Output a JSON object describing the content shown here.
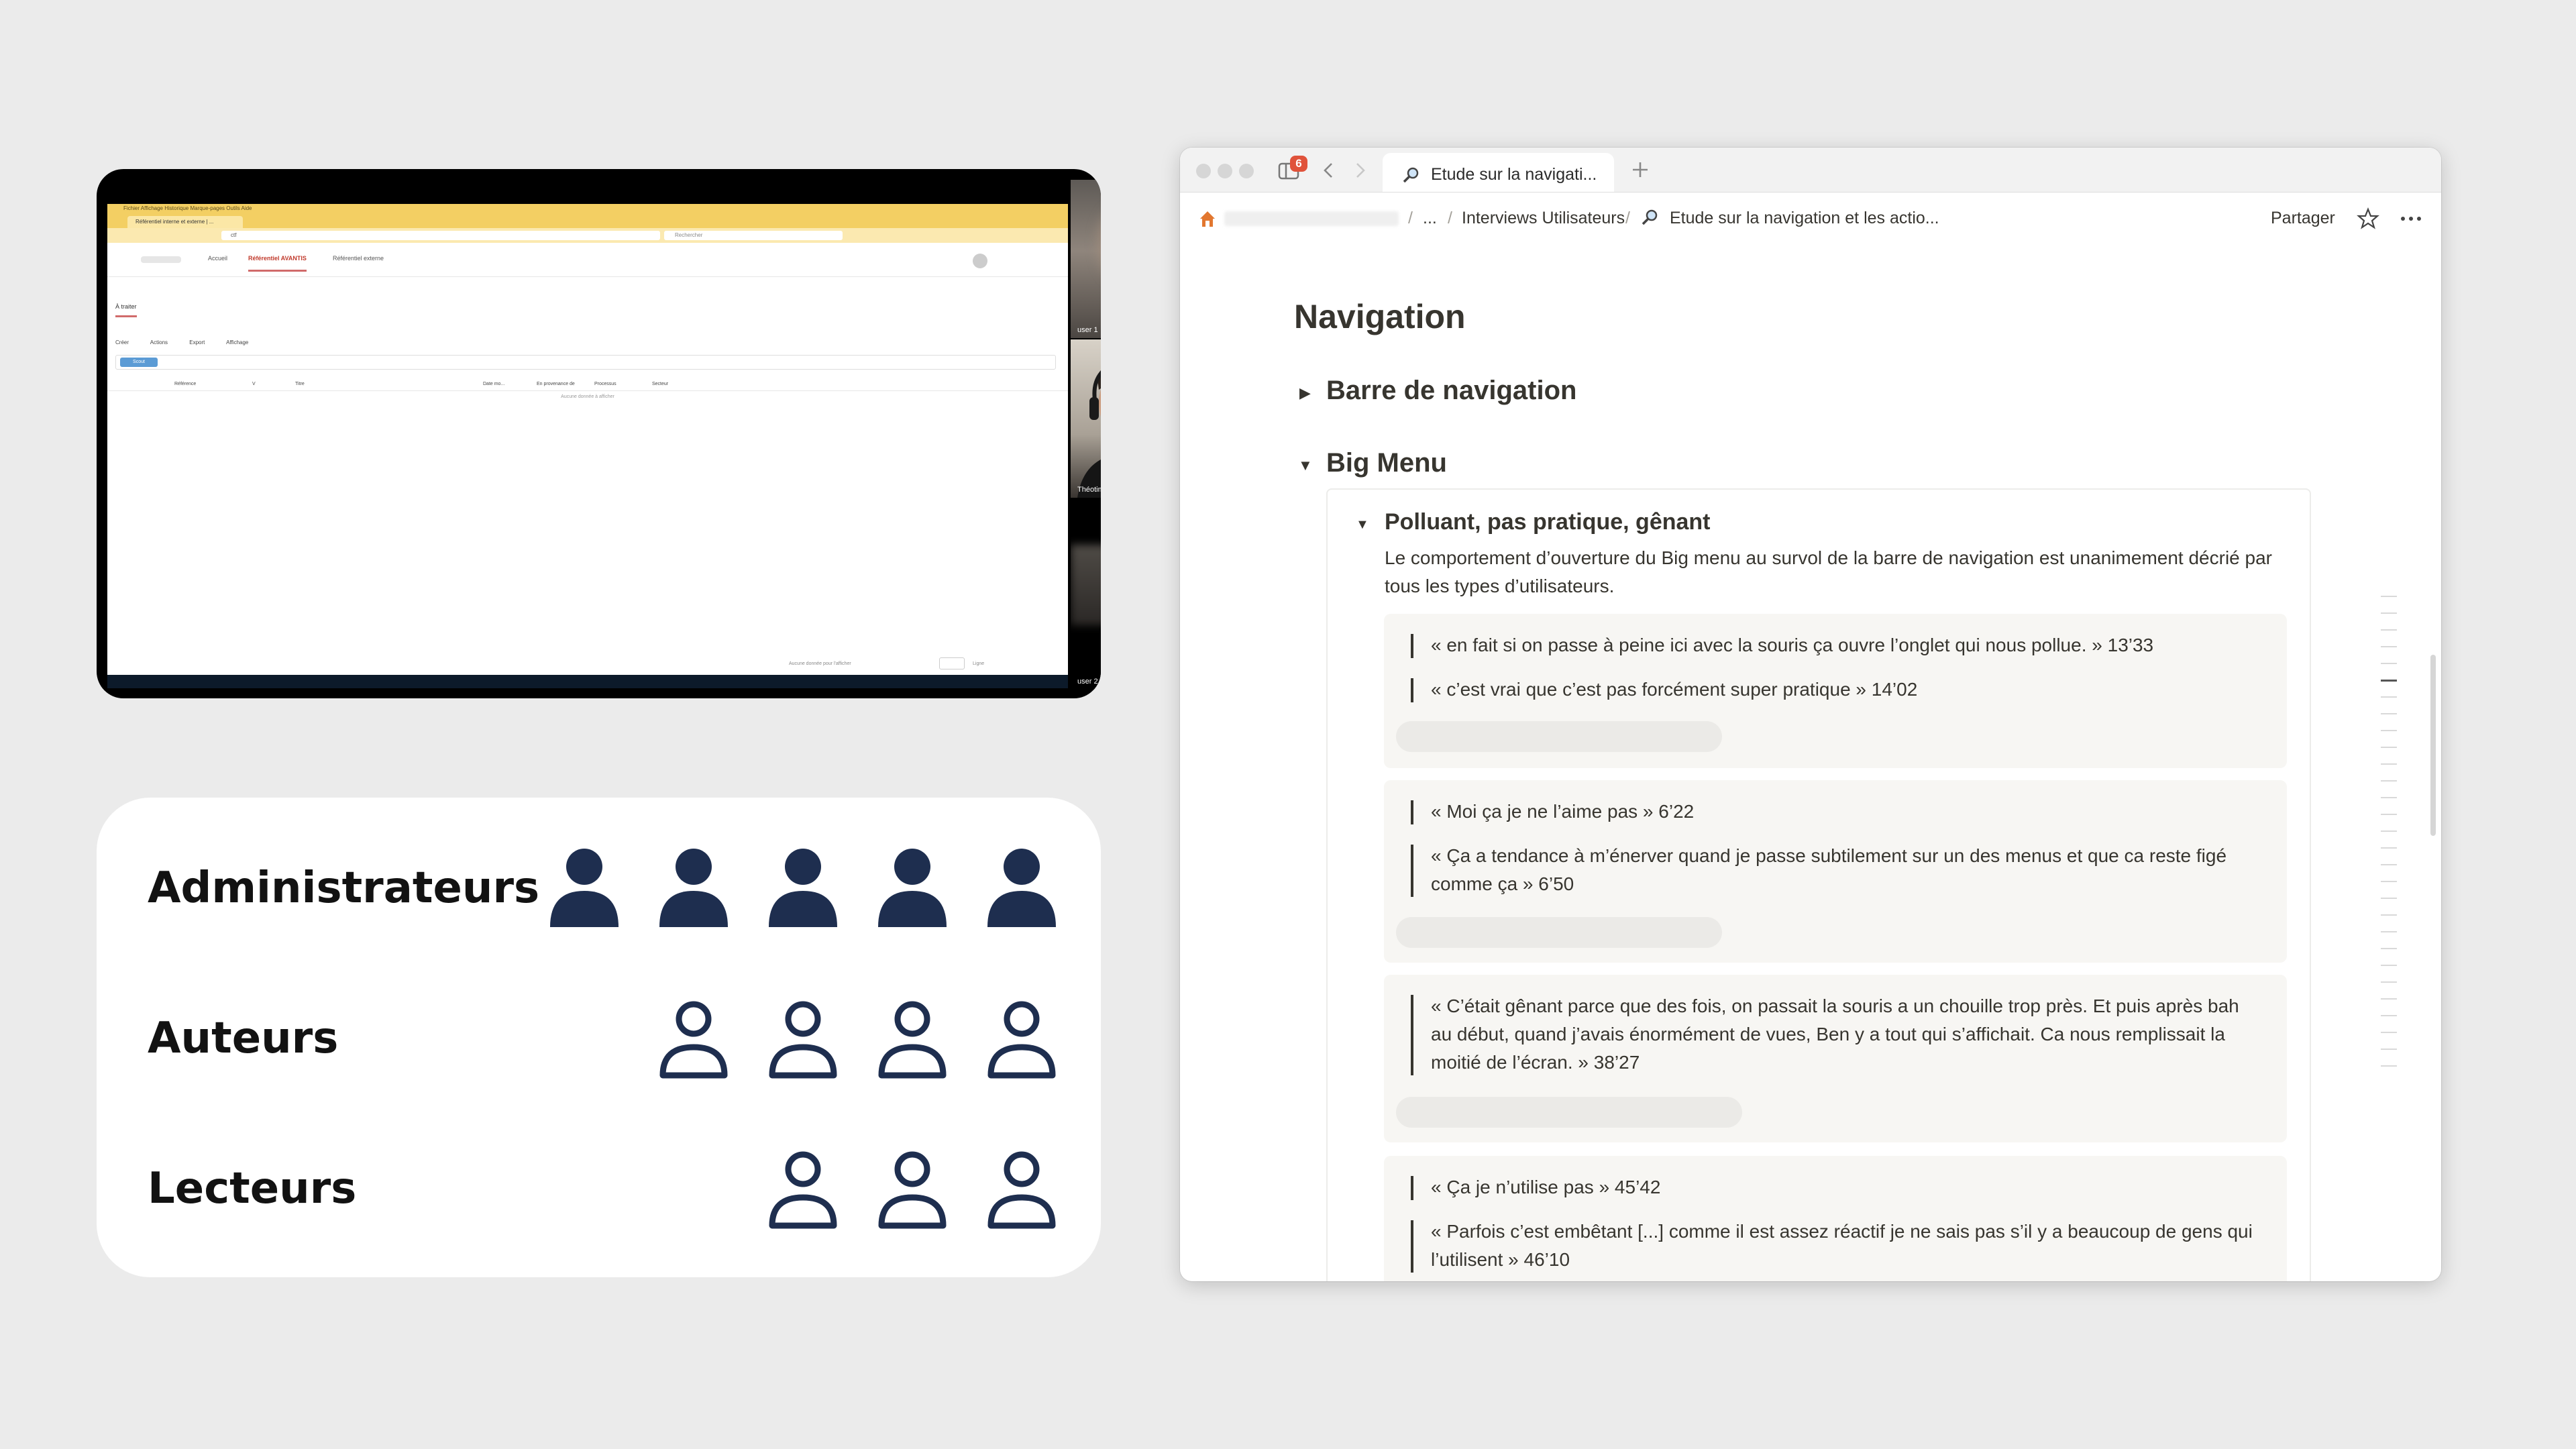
{
  "video": {
    "shared_screen": {
      "menubar": "Fichier  Affichage  Historique  Marque-pages  Outils  Aide",
      "tab_title": "Référentiel interne et externe | ...",
      "url": "ctf",
      "search_placeholder": "Rechercher",
      "nav": [
        "Accueil",
        "Référentiel AVANTIS",
        "Référentiel externe"
      ],
      "section_label": "À traiter",
      "toolbar": [
        "Créer",
        "Actions",
        "Export",
        "Affichage"
      ],
      "filter_chip": "Scout",
      "columns": [
        "Référence",
        "V",
        "Titre",
        "Date mo...",
        "En provenance de",
        "Processus",
        "Secteur"
      ],
      "empty": "Aucune donnée à afficher",
      "footer_left": "Aucune donnée pour l'afficher",
      "footer_right": "Ligne"
    },
    "participants": [
      {
        "name": "user 1"
      },
      {
        "name": "Théotim AUGER"
      },
      {
        "name": "user 2"
      }
    ]
  },
  "roles": [
    {
      "label": "Administrateurs",
      "count": 5,
      "style": "filled"
    },
    {
      "label": "Auteurs",
      "count": 4,
      "style": "outline"
    },
    {
      "label": "Lecteurs",
      "count": 3,
      "style": "outline"
    }
  ],
  "colors": {
    "role_icon": "#1e2e4f",
    "notion_text": "#37352f",
    "badge": "#e0533b"
  },
  "browser": {
    "tab_badge": "6",
    "tab_title": "Etude sur la navigati...",
    "breadcrumb": [
      "...",
      "Interviews Utilisateurs",
      "Etude sur la navigation et les actio..."
    ],
    "share_label": "Partager",
    "page": {
      "heading": "Navigation",
      "toggle1": "Barre de navigation",
      "toggle2": "Big Menu",
      "toggle3": "Polluant, pas pratique, gênant",
      "description": "Le comportement d’ouverture du Big menu au survol de la barre de navigation  est unanimement décrié par tous les types d’utilisateurs.",
      "quote_groups": [
        {
          "quotes": [
            "« en fait si on passe à peine ici avec la souris ça ouvre l’onglet qui nous pollue. » 13’33",
            "« c’est vrai que c’est pas forcément super pratique » 14’02"
          ]
        },
        {
          "quotes": [
            "« Moi ça je ne l’aime pas » 6’22",
            "« Ça a tendance à m’énerver quand je passe subtilement sur un des menus et que ca reste figé comme ça » 6’50"
          ]
        },
        {
          "quotes": [
            "« C’était gênant parce que des fois, on passait la souris a un chouille trop près. Et puis après bah au début, quand j’avais énormément de vues, Ben y a tout qui s’affichait. Ca nous remplissait la moitié de l’écran. »  38’27"
          ]
        },
        {
          "quotes": [
            "« Ça je n’utilise pas » 45’42",
            "« Parfois c’est embêtant [...] comme il est assez réactif je ne sais pas s’il y a beaucoup de gens qui l’utilisent » 46’10"
          ]
        }
      ]
    }
  }
}
